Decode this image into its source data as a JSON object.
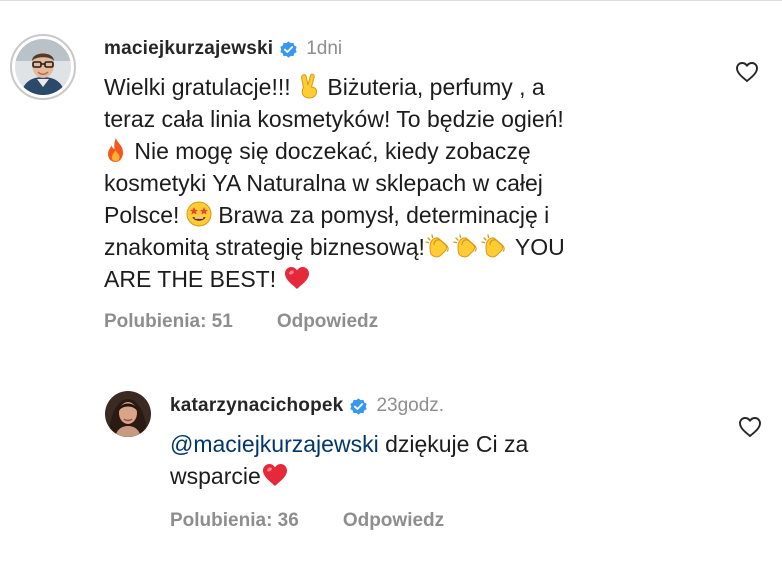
{
  "comments": [
    {
      "username": "maciejkurzajewski",
      "verified_icon": "verified-badge-icon",
      "time": "1dni",
      "lines": [
        [
          "Wielki gratulacje!!! ",
          "{victory-hand-emoji}",
          "  Biżuteria, perfumy , a"
        ],
        [
          "teraz cała linia kosmetyków! To będzie ogień!"
        ],
        [
          "{fire-emoji}",
          "  Nie mogę się doczekać, kiedy zobaczę"
        ],
        [
          "kosmetyki YA Naturalna w sklepach w całej"
        ],
        [
          "Polsce! ",
          "{star-struck-emoji}",
          "  Brawa za pomysł, determinację i"
        ],
        [
          "znakomitą strategię biznesową!",
          "{clapping-hands-emoji}",
          "{clapping-hands-emoji}",
          "{clapping-hands-emoji}",
          "  YOU"
        ],
        [
          "ARE THE BEST! ",
          "{red-heart-emoji}"
        ]
      ],
      "likes_label": "Polubienia: 51",
      "reply_label": "Odpowiedz"
    },
    {
      "username": "katarzynacichopek",
      "verified_icon": "verified-badge-icon",
      "time": "23godz.",
      "mention": "@maciejkurzajewski",
      "line1_rest": " dziękuje Ci za",
      "line2_text": "wsparcie",
      "line2_emoji": "{red-heart-emoji}",
      "likes_label": "Polubienia: 36",
      "reply_label": "Odpowiedz"
    }
  ],
  "colors": {
    "username": "#262626",
    "muted": "#8e8e8e",
    "mention": "#00376b",
    "verified": "#3897f0"
  }
}
